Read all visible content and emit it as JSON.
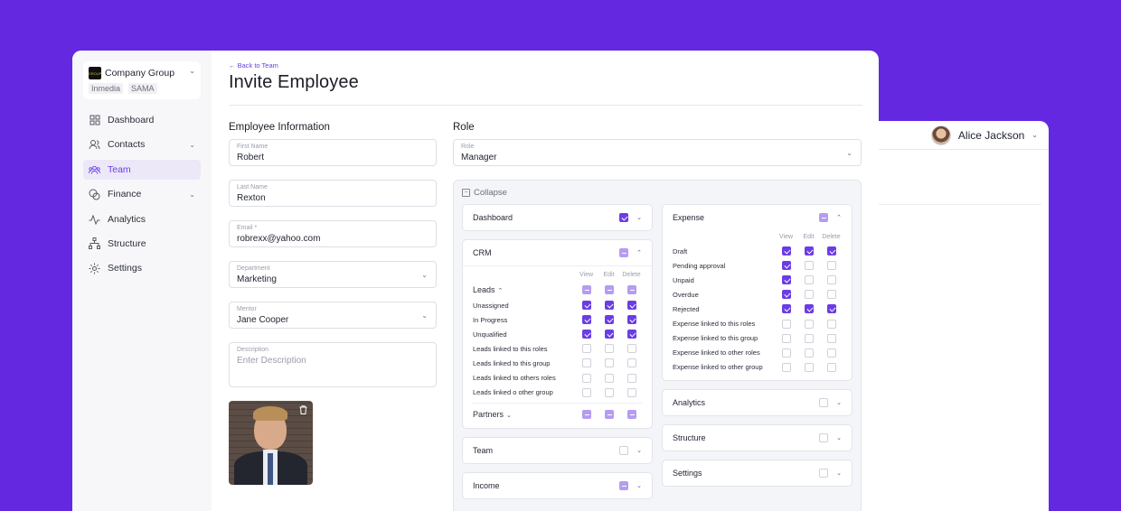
{
  "back_window": {
    "user_name": "Alice Jackson"
  },
  "sidebar": {
    "org_name": "Company Group",
    "org_tags": [
      "Inmedia",
      "SAMA"
    ],
    "items": [
      {
        "label": "Dashboard",
        "icon": "grid-icon"
      },
      {
        "label": "Contacts",
        "icon": "users-icon"
      },
      {
        "label": "Team",
        "icon": "team-icon"
      },
      {
        "label": "Finance",
        "icon": "coins-icon"
      },
      {
        "label": "Analytics",
        "icon": "pulse-icon"
      },
      {
        "label": "Structure",
        "icon": "hierarchy-icon"
      },
      {
        "label": "Settings",
        "icon": "gear-icon"
      }
    ]
  },
  "header": {
    "back_link": "← Back to Team",
    "title": "Invite Employee"
  },
  "employee": {
    "section_title": "Employee Information",
    "first_name": {
      "label": "First Name",
      "value": "Robert"
    },
    "last_name": {
      "label": "Last Name",
      "value": "Rexton"
    },
    "email": {
      "label": "Email *",
      "value": "robrexx@yahoo.com"
    },
    "department": {
      "label": "Department",
      "value": "Marketing"
    },
    "mentor": {
      "label": "Mentor",
      "value": "Jane Cooper"
    },
    "description": {
      "label": "Description",
      "placeholder": "Enter Description"
    }
  },
  "role": {
    "section_title": "Role",
    "field_label": "Role",
    "value": "Manager",
    "collapse_label": "Collapse",
    "col_headers": {
      "view": "View",
      "edit": "Edit",
      "delete": "Delete"
    },
    "dashboard": {
      "title": "Dashboard"
    },
    "crm": {
      "title": "CRM",
      "leads_label": "Leads",
      "partners_label": "Partners",
      "rows": [
        {
          "name": "Unassigned",
          "view": true,
          "edit": true,
          "delete": true
        },
        {
          "name": "In Progress",
          "view": true,
          "edit": true,
          "delete": true
        },
        {
          "name": "Unqualified",
          "view": true,
          "edit": true,
          "delete": true
        },
        {
          "name": "Leads linked to this roles",
          "view": false,
          "edit": false,
          "delete": false
        },
        {
          "name": "Leads linked to this group",
          "view": false,
          "edit": false,
          "delete": false
        },
        {
          "name": "Leads linked to others roles",
          "view": false,
          "edit": false,
          "delete": false
        },
        {
          "name": "Leads linked o other group",
          "view": false,
          "edit": false,
          "delete": false
        }
      ]
    },
    "team": {
      "title": "Team"
    },
    "income": {
      "title": "Income"
    },
    "expense": {
      "title": "Expense",
      "rows": [
        {
          "name": "Draft",
          "view": true,
          "edit": true,
          "delete": true
        },
        {
          "name": "Pending approval",
          "view": true,
          "edit": false,
          "delete": false
        },
        {
          "name": "Unpaid",
          "view": true,
          "edit": false,
          "delete": false
        },
        {
          "name": "Overdue",
          "view": true,
          "edit": false,
          "delete": false
        },
        {
          "name": "Rejected",
          "view": true,
          "edit": true,
          "delete": true
        },
        {
          "name": "Expense linked to this roles",
          "view": false,
          "edit": false,
          "delete": false
        },
        {
          "name": "Expense linked to this group",
          "view": false,
          "edit": false,
          "delete": false
        },
        {
          "name": "Expense linked to other roles",
          "view": false,
          "edit": false,
          "delete": false
        },
        {
          "name": "Expense linked to other group",
          "view": false,
          "edit": false,
          "delete": false
        }
      ]
    },
    "analytics": {
      "title": "Analytics"
    },
    "structure": {
      "title": "Structure"
    },
    "settings": {
      "title": "Settings"
    }
  },
  "colors": {
    "background": "#6428e0",
    "accent": "#6b3de4",
    "partial": "#b59cf0"
  }
}
